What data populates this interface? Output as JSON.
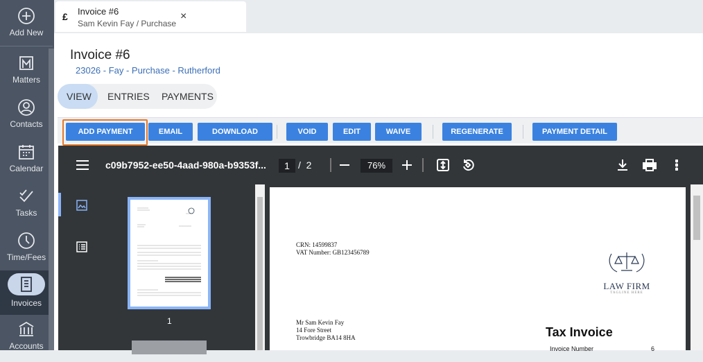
{
  "sidebar": {
    "items": [
      {
        "label": "Add New",
        "icon": "plus-circle-icon"
      },
      {
        "label": "Matters",
        "icon": "matters-icon"
      },
      {
        "label": "Contacts",
        "icon": "contact-icon"
      },
      {
        "label": "Calendar",
        "icon": "calendar-icon"
      },
      {
        "label": "Tasks",
        "icon": "tasks-icon"
      },
      {
        "label": "Time/Fees",
        "icon": "clock-icon"
      },
      {
        "label": "Invoices",
        "icon": "invoice-icon"
      },
      {
        "label": "Accounts",
        "icon": "bank-icon"
      }
    ]
  },
  "tab": {
    "currency": "£",
    "title": "Invoice #6",
    "subtitle": "Sam Kevin Fay / Purchase",
    "close": "×"
  },
  "header": {
    "title": "Invoice #6",
    "link": "23026 - Fay - Purchase - Rutherford"
  },
  "segments": [
    "VIEW",
    "ENTRIES",
    "PAYMENTS"
  ],
  "actions": [
    "ADD PAYMENT",
    "EMAIL",
    "DOWNLOAD",
    "VOID",
    "EDIT",
    "WAIVE",
    "REGENERATE",
    "PAYMENT DETAIL"
  ],
  "pdf": {
    "filename": "c09b7952-ee50-4aad-980a-b9353f...",
    "page": "1",
    "page_sep": "/",
    "pages": "2",
    "zoom": "76%",
    "thumb_page": "1"
  },
  "doc": {
    "crn": "CRN: 14599837",
    "vat": "VAT Number: GB123456789",
    "logo": "LAW FIRM",
    "tagline": "TAGLINE HERE",
    "addr": [
      "Mr Sam Kevin Fay",
      "14 Fore Street",
      "Trowbridge BA14 8HA"
    ],
    "heading": "Tax Invoice",
    "inv_label": "Invoice Number",
    "inv_value": "6"
  },
  "colors": {
    "accent": "#3b82e0",
    "highlight": "#e57a2c",
    "sidebar": "#4b5563"
  }
}
